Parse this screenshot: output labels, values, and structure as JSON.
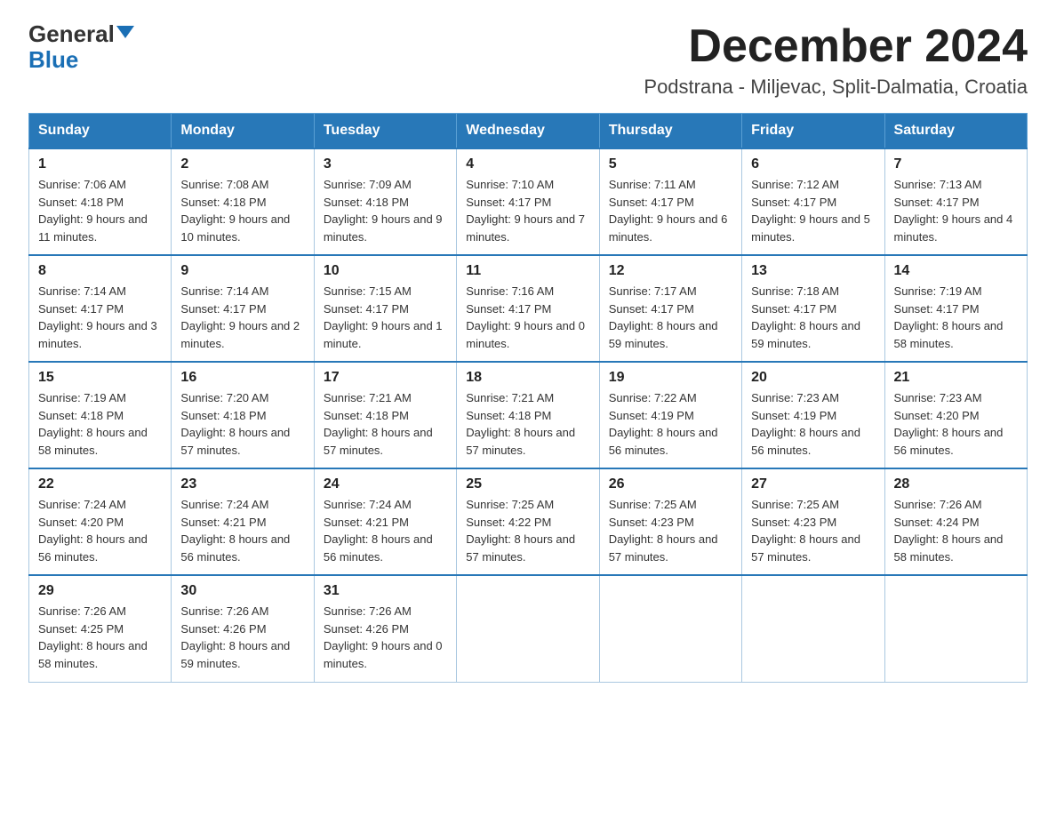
{
  "logo": {
    "general": "General",
    "blue": "Blue",
    "triangle": "▶"
  },
  "title": "December 2024",
  "subtitle": "Podstrana - Miljevac, Split-Dalmatia, Croatia",
  "days_header": [
    "Sunday",
    "Monday",
    "Tuesday",
    "Wednesday",
    "Thursday",
    "Friday",
    "Saturday"
  ],
  "weeks": [
    [
      {
        "num": "1",
        "sunrise": "7:06 AM",
        "sunset": "4:18 PM",
        "daylight": "9 hours and 11 minutes."
      },
      {
        "num": "2",
        "sunrise": "7:08 AM",
        "sunset": "4:18 PM",
        "daylight": "9 hours and 10 minutes."
      },
      {
        "num": "3",
        "sunrise": "7:09 AM",
        "sunset": "4:18 PM",
        "daylight": "9 hours and 9 minutes."
      },
      {
        "num": "4",
        "sunrise": "7:10 AM",
        "sunset": "4:17 PM",
        "daylight": "9 hours and 7 minutes."
      },
      {
        "num": "5",
        "sunrise": "7:11 AM",
        "sunset": "4:17 PM",
        "daylight": "9 hours and 6 minutes."
      },
      {
        "num": "6",
        "sunrise": "7:12 AM",
        "sunset": "4:17 PM",
        "daylight": "9 hours and 5 minutes."
      },
      {
        "num": "7",
        "sunrise": "7:13 AM",
        "sunset": "4:17 PM",
        "daylight": "9 hours and 4 minutes."
      }
    ],
    [
      {
        "num": "8",
        "sunrise": "7:14 AM",
        "sunset": "4:17 PM",
        "daylight": "9 hours and 3 minutes."
      },
      {
        "num": "9",
        "sunrise": "7:14 AM",
        "sunset": "4:17 PM",
        "daylight": "9 hours and 2 minutes."
      },
      {
        "num": "10",
        "sunrise": "7:15 AM",
        "sunset": "4:17 PM",
        "daylight": "9 hours and 1 minute."
      },
      {
        "num": "11",
        "sunrise": "7:16 AM",
        "sunset": "4:17 PM",
        "daylight": "9 hours and 0 minutes."
      },
      {
        "num": "12",
        "sunrise": "7:17 AM",
        "sunset": "4:17 PM",
        "daylight": "8 hours and 59 minutes."
      },
      {
        "num": "13",
        "sunrise": "7:18 AM",
        "sunset": "4:17 PM",
        "daylight": "8 hours and 59 minutes."
      },
      {
        "num": "14",
        "sunrise": "7:19 AM",
        "sunset": "4:17 PM",
        "daylight": "8 hours and 58 minutes."
      }
    ],
    [
      {
        "num": "15",
        "sunrise": "7:19 AM",
        "sunset": "4:18 PM",
        "daylight": "8 hours and 58 minutes."
      },
      {
        "num": "16",
        "sunrise": "7:20 AM",
        "sunset": "4:18 PM",
        "daylight": "8 hours and 57 minutes."
      },
      {
        "num": "17",
        "sunrise": "7:21 AM",
        "sunset": "4:18 PM",
        "daylight": "8 hours and 57 minutes."
      },
      {
        "num": "18",
        "sunrise": "7:21 AM",
        "sunset": "4:18 PM",
        "daylight": "8 hours and 57 minutes."
      },
      {
        "num": "19",
        "sunrise": "7:22 AM",
        "sunset": "4:19 PM",
        "daylight": "8 hours and 56 minutes."
      },
      {
        "num": "20",
        "sunrise": "7:23 AM",
        "sunset": "4:19 PM",
        "daylight": "8 hours and 56 minutes."
      },
      {
        "num": "21",
        "sunrise": "7:23 AM",
        "sunset": "4:20 PM",
        "daylight": "8 hours and 56 minutes."
      }
    ],
    [
      {
        "num": "22",
        "sunrise": "7:24 AM",
        "sunset": "4:20 PM",
        "daylight": "8 hours and 56 minutes."
      },
      {
        "num": "23",
        "sunrise": "7:24 AM",
        "sunset": "4:21 PM",
        "daylight": "8 hours and 56 minutes."
      },
      {
        "num": "24",
        "sunrise": "7:24 AM",
        "sunset": "4:21 PM",
        "daylight": "8 hours and 56 minutes."
      },
      {
        "num": "25",
        "sunrise": "7:25 AM",
        "sunset": "4:22 PM",
        "daylight": "8 hours and 57 minutes."
      },
      {
        "num": "26",
        "sunrise": "7:25 AM",
        "sunset": "4:23 PM",
        "daylight": "8 hours and 57 minutes."
      },
      {
        "num": "27",
        "sunrise": "7:25 AM",
        "sunset": "4:23 PM",
        "daylight": "8 hours and 57 minutes."
      },
      {
        "num": "28",
        "sunrise": "7:26 AM",
        "sunset": "4:24 PM",
        "daylight": "8 hours and 58 minutes."
      }
    ],
    [
      {
        "num": "29",
        "sunrise": "7:26 AM",
        "sunset": "4:25 PM",
        "daylight": "8 hours and 58 minutes."
      },
      {
        "num": "30",
        "sunrise": "7:26 AM",
        "sunset": "4:26 PM",
        "daylight": "8 hours and 59 minutes."
      },
      {
        "num": "31",
        "sunrise": "7:26 AM",
        "sunset": "4:26 PM",
        "daylight": "9 hours and 0 minutes."
      },
      null,
      null,
      null,
      null
    ]
  ],
  "labels": {
    "sunrise": "Sunrise:",
    "sunset": "Sunset:",
    "daylight": "Daylight:"
  }
}
